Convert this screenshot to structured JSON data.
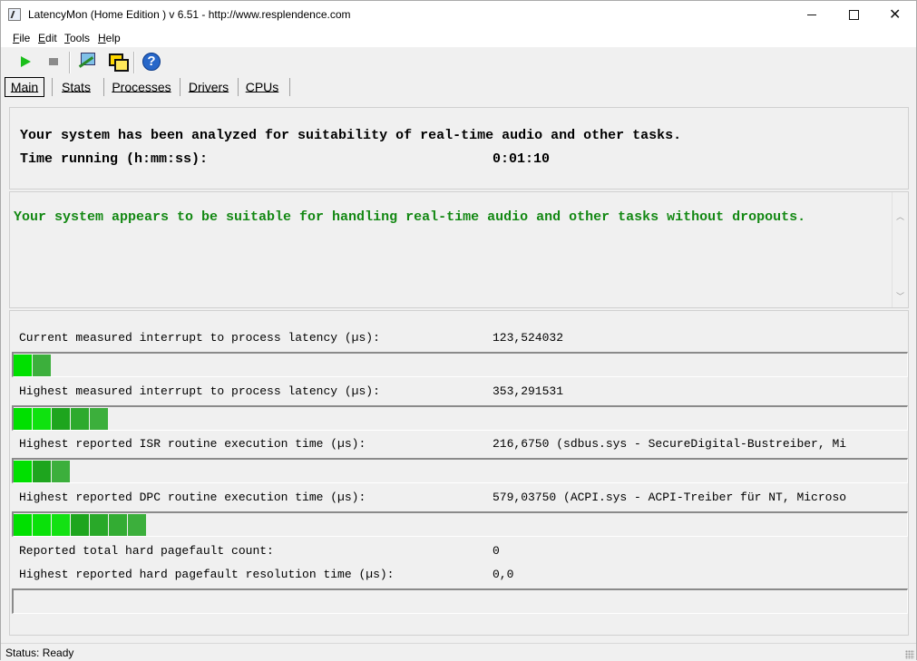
{
  "window": {
    "title": "LatencyMon  (Home Edition )  v 6.51 - http://www.resplendence.com"
  },
  "menu": [
    {
      "label": "File",
      "u": "F",
      "rest": "ile"
    },
    {
      "label": "Edit",
      "u": "E",
      "rest": "dit"
    },
    {
      "label": "Tools",
      "u": "T",
      "rest": "ools"
    },
    {
      "label": "Help",
      "u": "H",
      "rest": "elp"
    }
  ],
  "toolbar": {
    "icons": [
      "play-icon",
      "stop-icon",
      "drivers-icon",
      "windows-icon",
      "help-icon"
    ]
  },
  "tabs": [
    "Main",
    "Stats",
    "Processes",
    "Drivers",
    "CPUs"
  ],
  "active_tab": "Main",
  "summary": {
    "headline": "Your system has been analyzed for suitability of real-time audio and other tasks.",
    "time_label": "Time running (h:mm:ss):",
    "time_value": "0:01:10"
  },
  "verdict": {
    "message": "Your system appears to be suitable for handling real-time audio and other tasks without dropouts.",
    "color": "#138813"
  },
  "metrics": [
    {
      "label": "Current measured interrupt to process latency (µs):",
      "value": "123,524032",
      "segments": 2
    },
    {
      "label": "Highest measured interrupt to process latency (µs):",
      "value": "353,291531",
      "segments": 5
    },
    {
      "label": "Highest reported ISR routine execution time (µs):",
      "value": "216,6750   (sdbus.sys - SecureDigital-Bustreiber, Mi",
      "segments": 3
    },
    {
      "label": "Highest reported DPC routine execution time (µs):",
      "value": "579,03750   (ACPI.sys - ACPI-Treiber für NT, Microso",
      "segments": 7
    },
    {
      "label": "Reported total hard pagefault count:",
      "value": "0",
      "segments": null
    },
    {
      "label": "Highest reported hard pagefault resolution time (µs):",
      "value": "0,0",
      "segments": 0
    }
  ],
  "colors": {
    "bar_green_1": "#00e000",
    "bar_green_2": "#009a00"
  },
  "status": {
    "text": "Status: Ready"
  }
}
